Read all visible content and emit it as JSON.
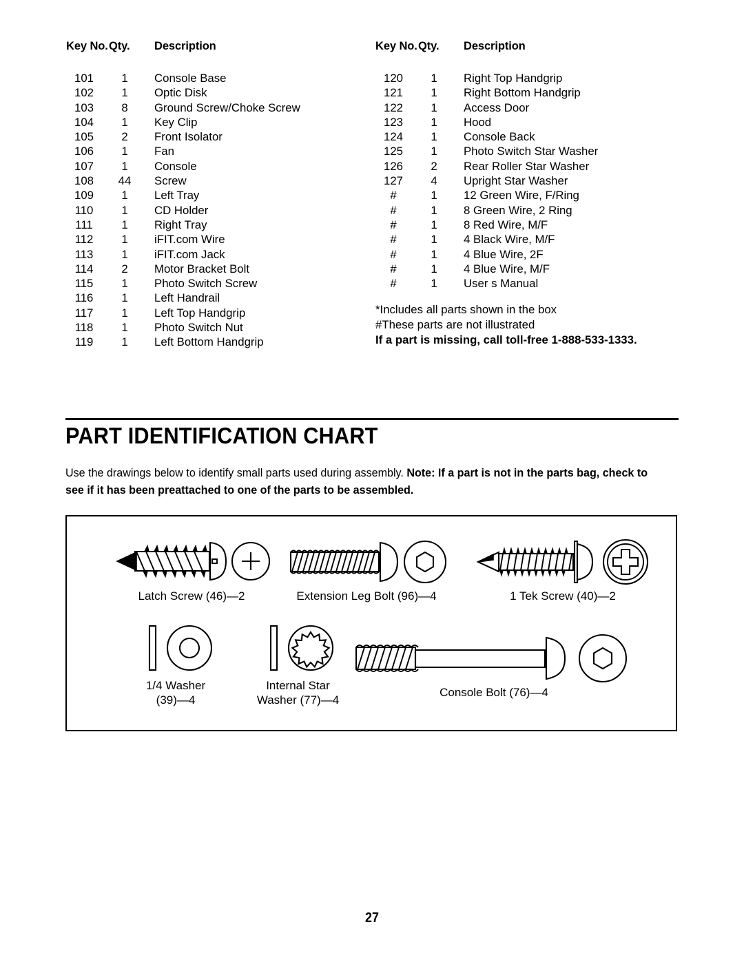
{
  "parts_list": {
    "columns": [
      {
        "headers": {
          "key_no": "Key No.",
          "qty": "Qty.",
          "description": "Description"
        },
        "rows": [
          {
            "key": "101",
            "qty": "1",
            "desc": "Console Base"
          },
          {
            "key": "102",
            "qty": "1",
            "desc": "Optic Disk"
          },
          {
            "key": "103",
            "qty": "8",
            "desc": "Ground Screw/Choke Screw"
          },
          {
            "key": "104",
            "qty": "1",
            "desc": "Key Clip"
          },
          {
            "key": "105",
            "qty": "2",
            "desc": "Front Isolator"
          },
          {
            "key": "106",
            "qty": "1",
            "desc": "Fan"
          },
          {
            "key": "107",
            "qty": "1",
            "desc": "Console"
          },
          {
            "key": "108",
            "qty": "44",
            "desc": "Screw"
          },
          {
            "key": "109",
            "qty": "1",
            "desc": "Left Tray"
          },
          {
            "key": "110",
            "qty": "1",
            "desc": "CD Holder"
          },
          {
            "key": "111",
            "qty": "1",
            "desc": "Right Tray"
          },
          {
            "key": "112",
            "qty": "1",
            "desc": "iFIT.com Wire"
          },
          {
            "key": "113",
            "qty": "1",
            "desc": "iFIT.com Jack"
          },
          {
            "key": "114",
            "qty": "2",
            "desc": "Motor Bracket Bolt"
          },
          {
            "key": "115",
            "qty": "1",
            "desc": "Photo Switch Screw"
          },
          {
            "key": "116",
            "qty": "1",
            "desc": "Left Handrail"
          },
          {
            "key": "117",
            "qty": "1",
            "desc": "Left Top Handgrip"
          },
          {
            "key": "118",
            "qty": "1",
            "desc": "Photo Switch Nut"
          },
          {
            "key": "119",
            "qty": "1",
            "desc": "Left Bottom Handgrip"
          }
        ]
      },
      {
        "headers": {
          "key_no": "Key No.",
          "qty": "Qty.",
          "description": "Description"
        },
        "rows": [
          {
            "key": "120",
            "qty": "1",
            "desc": "Right Top Handgrip"
          },
          {
            "key": "121",
            "qty": "1",
            "desc": "Right Bottom Handgrip"
          },
          {
            "key": "122",
            "qty": "1",
            "desc": "Access Door"
          },
          {
            "key": "123",
            "qty": "1",
            "desc": "Hood"
          },
          {
            "key": "124",
            "qty": "1",
            "desc": "Console Back"
          },
          {
            "key": "125",
            "qty": "1",
            "desc": "Photo Switch Star Washer"
          },
          {
            "key": "126",
            "qty": "2",
            "desc": "Rear Roller Star Washer"
          },
          {
            "key": "127",
            "qty": "4",
            "desc": "Upright Star Washer"
          },
          {
            "key": "#",
            "qty": "1",
            "desc": "12  Green Wire, F/Ring"
          },
          {
            "key": "#",
            "qty": "1",
            "desc": "8  Green Wire, 2 Ring"
          },
          {
            "key": "#",
            "qty": "1",
            "desc": "8  Red Wire, M/F"
          },
          {
            "key": "#",
            "qty": "1",
            "desc": "4  Black Wire, M/F"
          },
          {
            "key": "#",
            "qty": "1",
            "desc": "4  Blue Wire, 2F"
          },
          {
            "key": "#",
            "qty": "1",
            "desc": "4  Blue Wire, M/F"
          },
          {
            "key": "#",
            "qty": "1",
            "desc": "User s Manual"
          }
        ],
        "footnotes": {
          "line1": "*Includes all parts shown in the box",
          "line2": "#These parts are not illustrated",
          "line3": "If a part is missing, call toll-free 1-888-533-1333."
        }
      }
    ]
  },
  "section": {
    "title": "PART IDENTIFICATION CHART",
    "intro_plain": "Use the drawings below to identify small parts used during assembly. ",
    "intro_bold": "Note: If a part is not in the parts bag, check to see if it has been preattached to one of the parts to be assembled."
  },
  "part_figures": [
    {
      "id": "latch-screw",
      "label": "Latch Screw (46)—2"
    },
    {
      "id": "extension-bolt",
      "label": "Extension Leg Bolt (96)—4"
    },
    {
      "id": "tek-screw",
      "label": "1  Tek Screw (40)—2"
    },
    {
      "id": "quarter-washer",
      "label_line1": "1/4  Washer",
      "label_line2": "(39)—4"
    },
    {
      "id": "star-washer",
      "label_line1": "Internal Star",
      "label_line2": "Washer (77)—4"
    },
    {
      "id": "console-bolt",
      "label": "Console Bolt (76)—4"
    }
  ],
  "page_number": "27"
}
